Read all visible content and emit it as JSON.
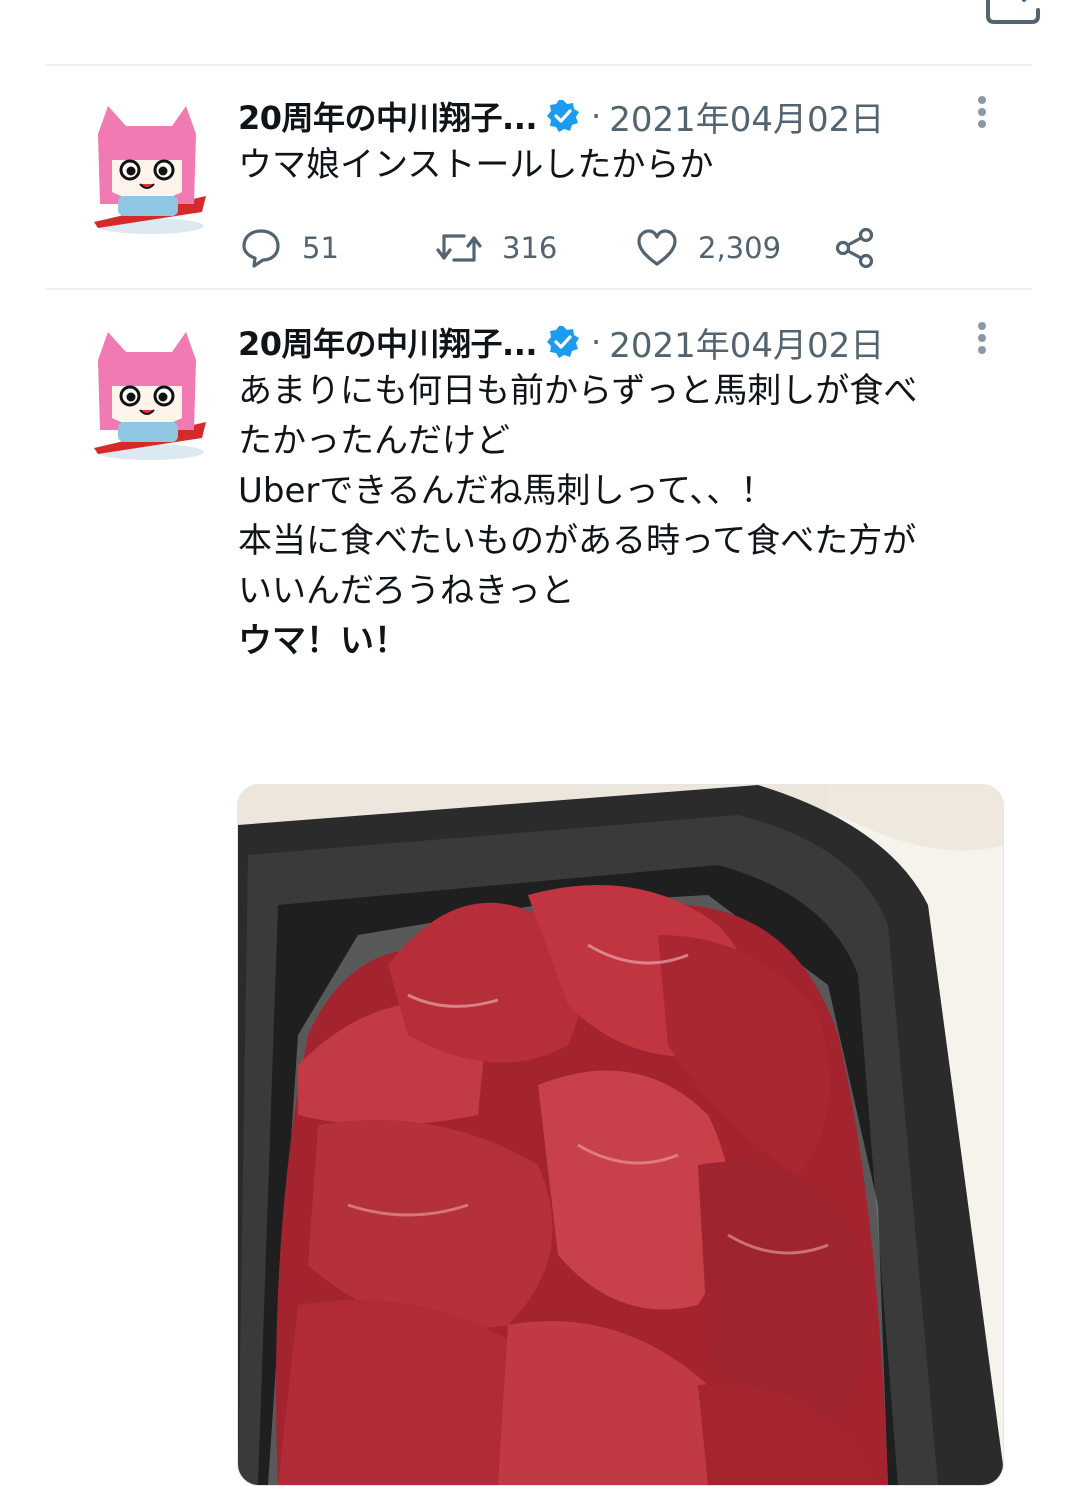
{
  "tweets": [
    {
      "author_name": "20周年の中川翔子...",
      "separator": "·",
      "date": "2021年04月02日",
      "lines": [
        "ウマ娘インストールしたからか"
      ],
      "stats": {
        "replies": "51",
        "retweets": "316",
        "likes": "2,309"
      }
    },
    {
      "author_name": "20周年の中川翔子...",
      "separator": "·",
      "date": "2021年04月02日",
      "lines": [
        "あまりにも何日も前からずっと馬刺しが食べ",
        "たかったんだけど",
        "",
        "Uberできるんだね馬刺しって、、！",
        "",
        "本当に食べたいものがある時って食べた方が",
        "いいんだろうねきっと"
      ],
      "bold_line": "ウマ！い！"
    }
  ],
  "icons": {
    "verified": "verified-badge-icon",
    "more": "more-vertical-icon",
    "reply": "reply-bubble-icon",
    "retweet": "retweet-icon",
    "like": "heart-icon",
    "share": "share-icon",
    "compose": "compose-icon"
  },
  "colors": {
    "verified_blue": "#1d9bf0",
    "secondary_text": "#536471",
    "avatar_pink": "#f07ab1",
    "meat_red": "#b22b36"
  }
}
